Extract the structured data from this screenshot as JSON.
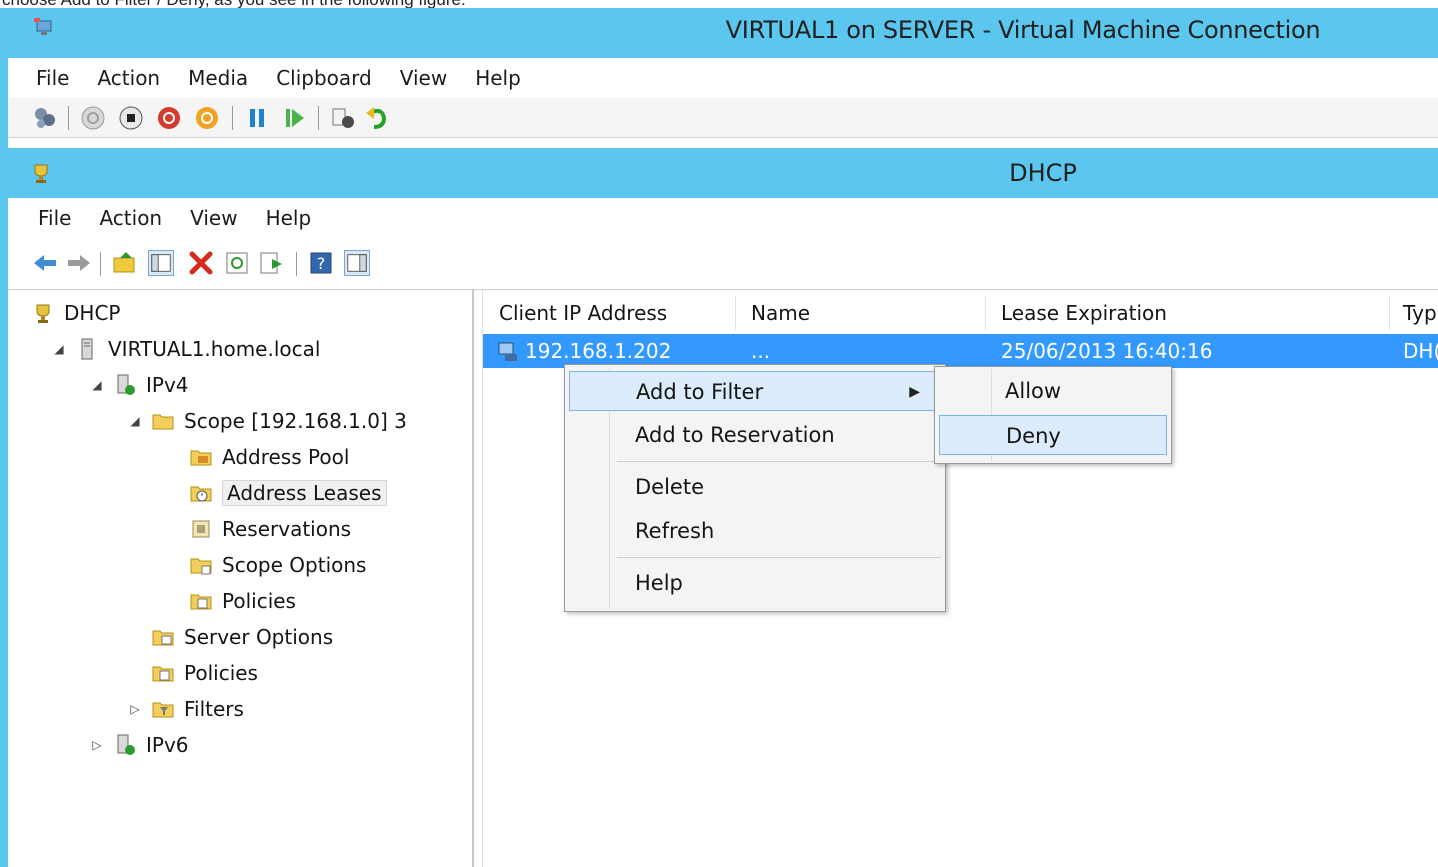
{
  "caption": "choose Add to Filter / Deny, as you see in the following figure.",
  "vm": {
    "title": "VIRTUAL1 on SERVER - Virtual Machine Connection",
    "menu": [
      "File",
      "Action",
      "Media",
      "Clipboard",
      "View",
      "Help"
    ]
  },
  "dhcp": {
    "title": "DHCP",
    "menu": [
      "File",
      "Action",
      "View",
      "Help"
    ]
  },
  "tree": {
    "root": "DHCP",
    "server": "VIRTUAL1.home.local",
    "ipv4": "IPv4",
    "scope": "Scope [192.168.1.0] 3",
    "address_pool": "Address Pool",
    "address_leases": "Address Leases",
    "reservations": "Reservations",
    "scope_options": "Scope Options",
    "scope_policies": "Policies",
    "server_options": "Server Options",
    "policies": "Policies",
    "filters": "Filters",
    "ipv6": "IPv6"
  },
  "columns": [
    "Client IP Address",
    "Name",
    "Lease Expiration",
    "Typ"
  ],
  "lease_row": {
    "ip": "192.168.1.202",
    "name": "...",
    "expiration": "25/06/2013 16:40:16",
    "type": "DH("
  },
  "context_menu": {
    "add_to_filter": "Add to Filter",
    "add_to_reservation": "Add to Reservation",
    "delete": "Delete",
    "refresh": "Refresh",
    "help": "Help"
  },
  "submenu": {
    "allow": "Allow",
    "deny": "Deny"
  },
  "colors": {
    "titlebar": "#5cc7ee",
    "selection": "#3399ff",
    "menu_hover": "#dcecfc"
  }
}
